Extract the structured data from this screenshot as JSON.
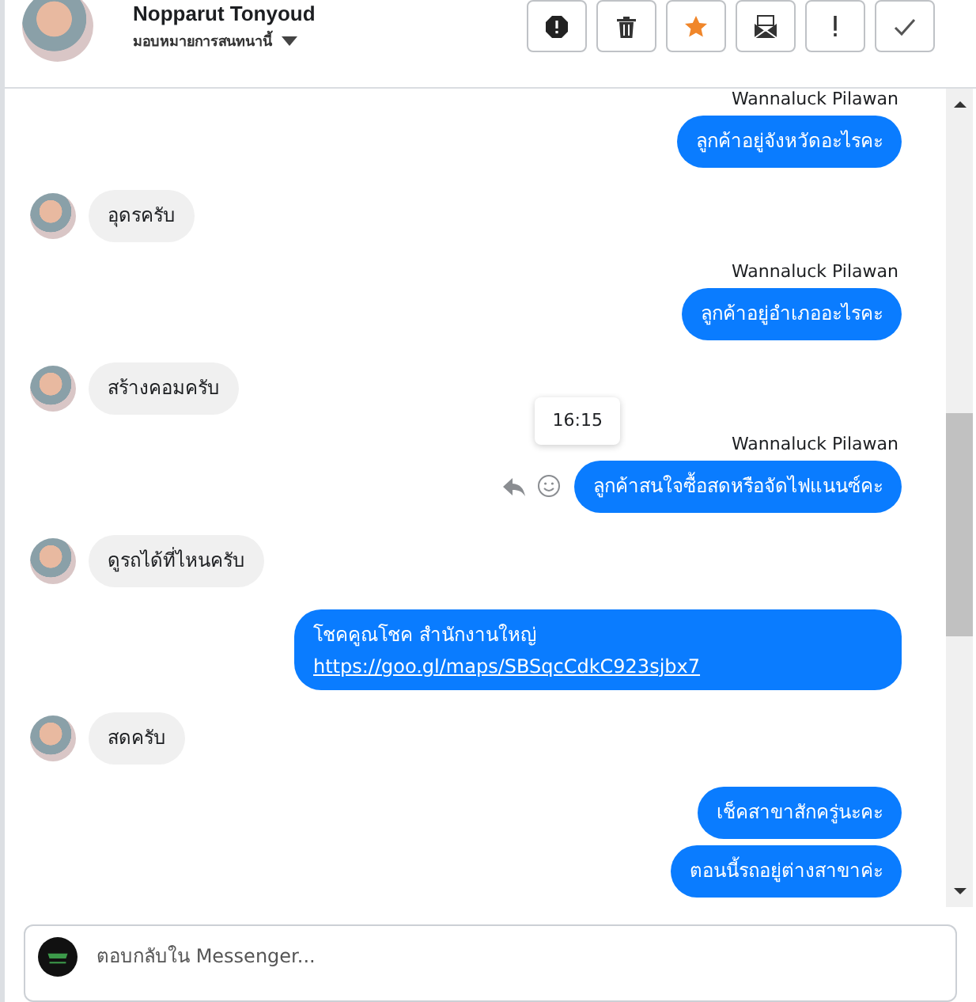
{
  "header": {
    "name": "Nopparut Tonyoud",
    "subtitle": "มอบหมายการสนทนานี้"
  },
  "toolbar": [
    {
      "kind": "alert"
    },
    {
      "kind": "trash"
    },
    {
      "kind": "star"
    },
    {
      "kind": "envelope"
    },
    {
      "kind": "exclaim"
    },
    {
      "kind": "check"
    }
  ],
  "messages": [
    {
      "kind": "outgoing",
      "sender": "Wannaluck Pilawan",
      "text": "ลูกค้าอยู่จังหวัดอะไรคะ"
    },
    {
      "kind": "incoming",
      "text": "อุดรครับ"
    },
    {
      "kind": "outgoing",
      "sender": "Wannaluck Pilawan",
      "text": "ลูกค้าอยู่อำเภออะไรคะ"
    },
    {
      "kind": "incoming",
      "text": "สร้างคอมครับ"
    },
    {
      "kind": "outgoing",
      "sender": "Wannaluck Pilawan",
      "time": "16:15",
      "hovered": true,
      "text": "ลูกค้าสนใจซื้อสดหรือจัดไฟแนนซ์คะ"
    },
    {
      "kind": "incoming",
      "text": "ดูรถได้ที่ไหนครับ"
    },
    {
      "kind": "outgoing",
      "text": "โชคคูณโชค สำนักงานใหญ่",
      "link": "https://goo.gl/maps/SBSqcCdkC923sjbx7"
    },
    {
      "kind": "incoming",
      "text": "สดครับ"
    },
    {
      "kind": "outgoing",
      "text": "เช็คสาขาสักครู่นะคะ"
    },
    {
      "kind": "outgoing",
      "text": "ตอนนี้รถอยู่ต่างสาขาค่ะ"
    }
  ],
  "composer": {
    "placeholder": "ตอบกลับใน Messenger..."
  }
}
